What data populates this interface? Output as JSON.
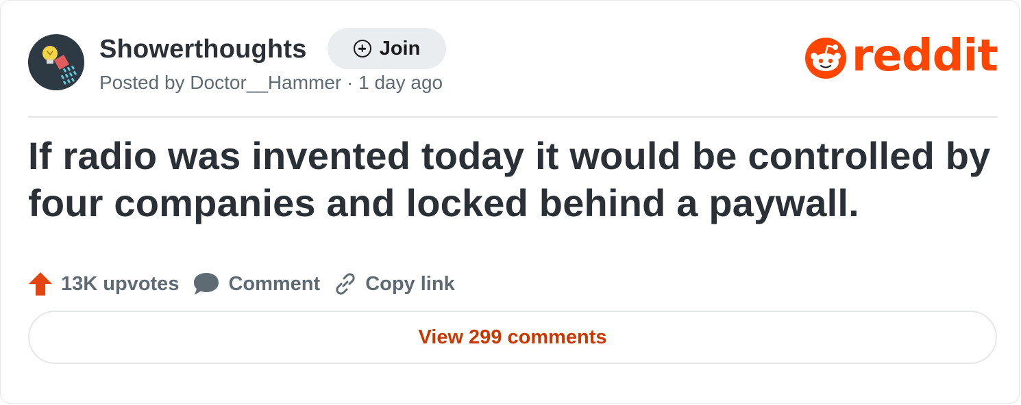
{
  "post": {
    "subreddit": "Showerthoughts",
    "join_label": "Join",
    "meta": "Posted by Doctor__Hammer · 1 day ago",
    "title": "If radio was invented today it would be controlled by four companies and locked behind a paywall.",
    "actions": {
      "upvotes": "13K upvotes",
      "comment": "Comment",
      "copy_link": "Copy link"
    },
    "view_comments": "View 299 comments"
  },
  "brand": {
    "wordmark": "reddit",
    "color": "#ff4500"
  },
  "icons": {
    "avatar": "showerhead-lightbulb-icon",
    "join": "plus-circle-icon",
    "logo": "reddit-alien-icon",
    "upvote": "upvote-arrow-icon",
    "comment": "comment-bubble-icon",
    "link": "link-icon"
  }
}
